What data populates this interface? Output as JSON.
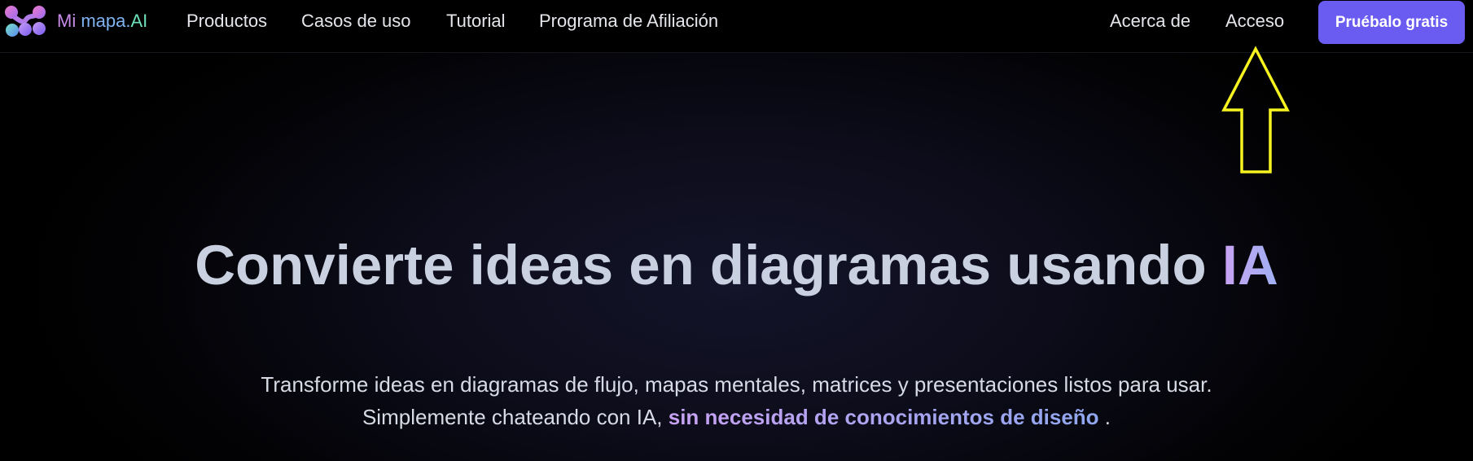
{
  "nav": {
    "brand_part1": "Mi ",
    "brand_part2": "mapa.",
    "brand_part3": "AI",
    "links": [
      {
        "label": "Productos"
      },
      {
        "label": "Casos de uso"
      },
      {
        "label": "Tutorial"
      },
      {
        "label": "Programa de Afiliación"
      }
    ],
    "about_label": "Acerca de",
    "login_label": "Acceso",
    "cta_label": "Pruébalo gratis"
  },
  "annotation": {
    "icon": "arrow-up-icon",
    "color": "#f6f321"
  },
  "hero": {
    "title_main": "Convierte ideas en diagramas usando ",
    "title_accent": "IA",
    "subtitle_line1": "Transforme ideas en diagramas de flujo, mapas mentales, matrices y presentaciones listos para usar.",
    "subtitle_line2_prefix": "Simplemente chateando con IA, ",
    "subtitle_highlight": "sin necesidad de conocimientos de diseño",
    "subtitle_line2_suffix": " ."
  },
  "colors": {
    "cta_background": "#6a5cf0",
    "accent_purple": "#c8a2f2",
    "accent_blue": "#9fb0f2"
  }
}
